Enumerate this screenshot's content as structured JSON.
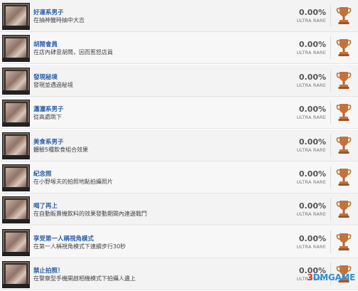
{
  "trophies": [
    {
      "title": "好運系男子",
      "desc": "在抽神籤時抽中大吉",
      "percent": "0.00%",
      "rarity": "ULTRA RARE",
      "grade": "bronze"
    },
    {
      "title": "胡鬧會員",
      "desc": "在店內肆意胡鬧，因而惹怒店員",
      "percent": "0.00%",
      "rarity": "ULTRA RARE",
      "grade": "bronze"
    },
    {
      "title": "發現秘境",
      "desc": "發現並遇過秘境",
      "percent": "0.00%",
      "rarity": "ULTRA RARE",
      "grade": "bronze"
    },
    {
      "title": "瀟灑系男子",
      "desc": "從高處跳下",
      "percent": "0.00%",
      "rarity": "ULTRA RARE",
      "grade": "bronze"
    },
    {
      "title": "美食系男子",
      "desc": "體驗5種飲食組合效果",
      "percent": "0.00%",
      "rarity": "ULTRA RARE",
      "grade": "bronze"
    },
    {
      "title": "紀念照",
      "desc": "在小野塚夫的拍照地點拍攝照片",
      "percent": "0.00%",
      "rarity": "ULTRA RARE",
      "grade": "bronze"
    },
    {
      "title": "喝了再上",
      "desc": "在自動販賣機飲料的效果發動期間內連邊戰鬥",
      "percent": "0.00%",
      "rarity": "ULTRA RARE",
      "grade": "bronze"
    },
    {
      "title": "享受第一人稱視角模式",
      "desc": "在第一人稱視角模式下連續步行30秒",
      "percent": "0.00%",
      "rarity": "ULTRA RARE",
      "grade": "bronze"
    },
    {
      "title": "禁止拍照！",
      "desc": "在警察型手機開啟相機模式下拍攝人遺上",
      "percent": "0.00%",
      "rarity": "ULTRA RARE",
      "grade": "bronze"
    }
  ],
  "colors": {
    "title": "#2c5fa8",
    "trophy_bronze": "#c4723a"
  },
  "icons": {
    "thumbnail": "trophy-thumbnail",
    "grade": "bronze-trophy-icon"
  },
  "watermark": {
    "prefix": "3",
    "text": "DMGAME"
  }
}
